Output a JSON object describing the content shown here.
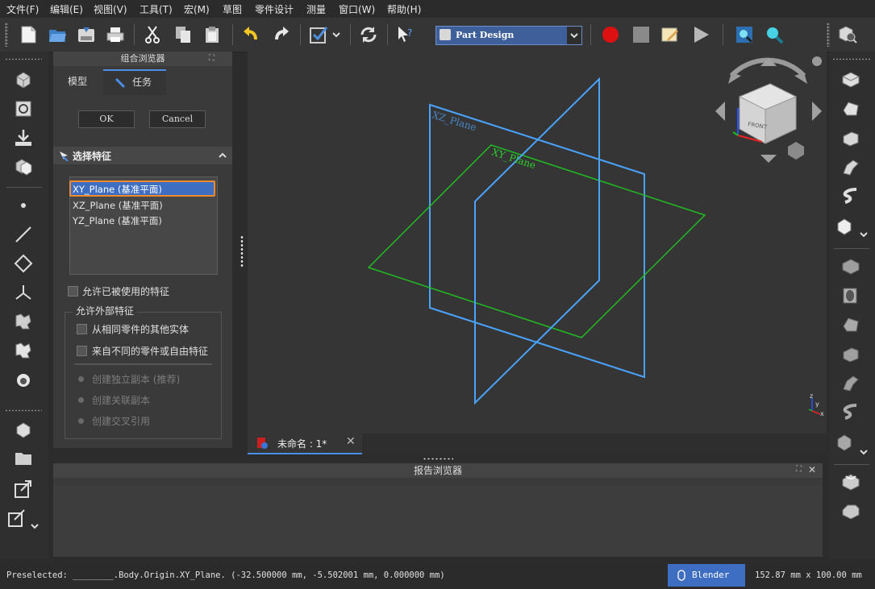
{
  "menu": [
    "文件(F)",
    "编辑(E)",
    "视图(V)",
    "工具(T)",
    "宏(M)",
    "草图",
    "零件设计",
    "测量",
    "窗口(W)",
    "帮助(H)"
  ],
  "toolbar": {
    "workbench": "Part Design",
    "icons": [
      "new-document-icon",
      "open-icon",
      "save-icon",
      "print-icon",
      "cut-icon",
      "copy-icon",
      "paste-icon",
      "undo-icon",
      "redo-icon",
      "check-icon",
      "refresh-icon",
      "whats-this-icon",
      "record-macro-icon",
      "stop-macro-icon",
      "edit-macro-icon",
      "run-macro-icon",
      "zoom-fit-icon",
      "zoom-select-icon",
      "measure-icon"
    ]
  },
  "combo_view": {
    "title": "组合浏览器",
    "tabs": [
      "模型",
      "任务"
    ],
    "ok_label": "OK",
    "cancel_label": "Cancel",
    "section_title": "选择特征",
    "features": [
      "XY_Plane (基准平面)",
      "XZ_Plane (基准平面)",
      "YZ_Plane (基准平面)"
    ],
    "selected_feature_index": 0,
    "allow_used_label": "允许已被使用的特征",
    "external_group_label": "允许外部特征",
    "from_same_part_label": "从相同零件的其他实体",
    "from_other_part_label": "来自不同的零件或自由特征",
    "radio_options": [
      "创建独立副本 (推荐)",
      "创建关联副本",
      "创建交叉引用"
    ]
  },
  "viewport": {
    "plane_labels": [
      "XZ_Plane",
      "XY_Plane"
    ],
    "navcube_face": "FRONT",
    "colors": {
      "xz_plane": "#4aa3ff",
      "xy_plane": "#22bb22",
      "background": "#353535"
    }
  },
  "document_tab": {
    "label": "未命名 : 1*"
  },
  "report_view": {
    "title": "报告浏览器"
  },
  "status": {
    "preselected": "Preselected: ________.Body.Origin.XY_Plane. (-32.500000 mm, -5.502001 mm, 0.000000 mm)",
    "navigation_style": "Blender",
    "dimensions": "152.87 mm x 100.00 mm"
  }
}
